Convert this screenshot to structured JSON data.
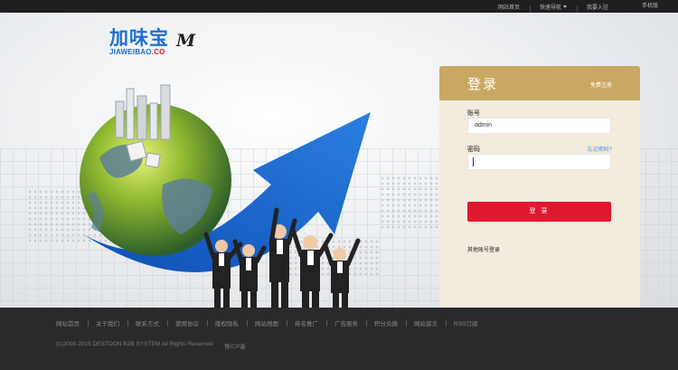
{
  "topbar": {
    "links": [
      "网站首页",
      "快速导航",
      "我要入驻"
    ],
    "quicknav_index": 1,
    "mobile": "手机版"
  },
  "logo": {
    "cn": "加味宝",
    "m": "M",
    "en_prefix": "JIAWEIBAO.",
    "en_suffix": "CO"
  },
  "login": {
    "title": "登录",
    "register": "免费注册",
    "username_label": "账号",
    "username_value": "admin",
    "password_label": "密码",
    "forgot": "忘记密码?",
    "submit": "登 录",
    "other": "其他账号登录"
  },
  "footer": {
    "links": [
      "网站首页",
      "关于我们",
      "联系方式",
      "使用协议",
      "版权隐私",
      "网站地图",
      "排名推广",
      "广告服务",
      "积分兑换",
      "网站留言",
      "RSS订阅"
    ],
    "copyright": "(c)2008-2015 DESTOON B2B SYSTEM All Rights Reserved",
    "icp": "豫ICP备"
  },
  "colors": {
    "accent": "#c9a862",
    "button": "#e0182f",
    "logo_blue": "#1d6fd1"
  }
}
